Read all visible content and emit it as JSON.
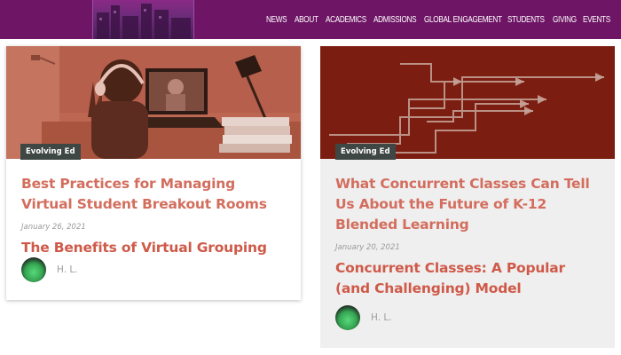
{
  "nav": {
    "items": [
      "NEWS",
      "ABOUT",
      "ACADEMICS",
      "ADMISSIONS",
      "GLOBAL ENGAGEMENT",
      "STUDENTS",
      "GIVING",
      "EVENTS"
    ]
  },
  "colors": {
    "header_bg": "#6e1565",
    "headline": "#d36e5e",
    "subhead": "#cf5a49",
    "tag_bg": "#3f4744"
  },
  "cards": [
    {
      "tag": "Evolving Ed",
      "headline": "Best Practices for Managing Virtual Student Breakout Rooms",
      "date": "January 26, 2021",
      "subhead": "The Benefits of Virtual Grouping",
      "author": "H. L."
    },
    {
      "tag": "Evolving Ed",
      "headline": "What Concurrent Classes Can Tell Us About the Future of K-12 Blended Learning",
      "date": "January 20, 2021",
      "subhead": "Concurrent Classes: A Popular (and Challenging) Model",
      "author": "H. L."
    }
  ]
}
